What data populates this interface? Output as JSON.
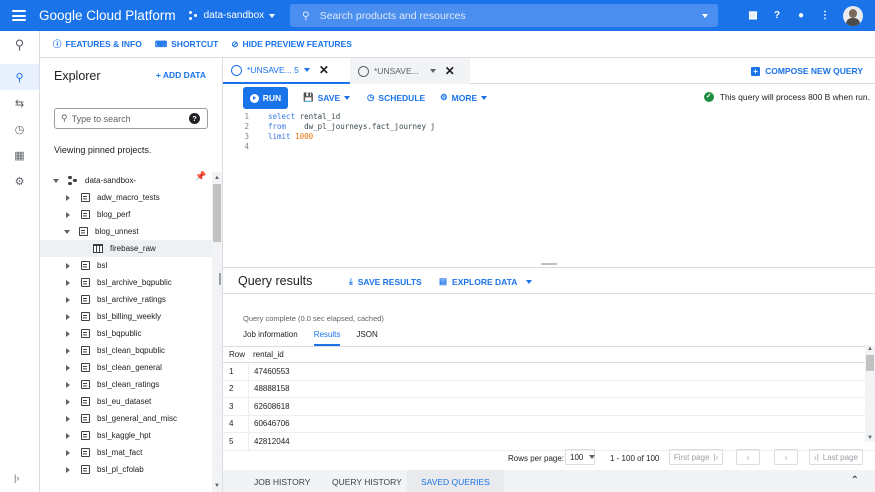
{
  "header": {
    "brand": "Google Cloud Platform",
    "project": "data-sandbox",
    "search_placeholder": "Search products and resources"
  },
  "infobar": {
    "features": "FEATURES & INFO",
    "shortcut": "SHORTCUT",
    "hide_preview": "HIDE PREVIEW FEATURES"
  },
  "explorer": {
    "title": "Explorer",
    "add_data": "+ ADD DATA",
    "search_placeholder": "Type to search",
    "pinned_text": "Viewing pinned projects.",
    "project": "data-sandbox-",
    "items": [
      {
        "label": "adw_macro_tests",
        "state": "collapsed"
      },
      {
        "label": "blog_perf",
        "state": "collapsed"
      },
      {
        "label": "blog_unnest",
        "state": "expanded"
      },
      {
        "label": "firebase_raw",
        "state": "table"
      },
      {
        "label": "bsl",
        "state": "collapsed"
      },
      {
        "label": "bsl_archive_bqpublic",
        "state": "collapsed"
      },
      {
        "label": "bsl_archive_ratings",
        "state": "collapsed"
      },
      {
        "label": "bsl_billing_weekly",
        "state": "collapsed"
      },
      {
        "label": "bsl_bqpublic",
        "state": "collapsed"
      },
      {
        "label": "bsl_clean_bqpublic",
        "state": "collapsed"
      },
      {
        "label": "bsl_clean_general",
        "state": "collapsed"
      },
      {
        "label": "bsl_clean_ratings",
        "state": "collapsed"
      },
      {
        "label": "bsl_eu_dataset",
        "state": "collapsed"
      },
      {
        "label": "bsl_general_and_misc",
        "state": "collapsed"
      },
      {
        "label": "bsl_kaggle_hpt",
        "state": "collapsed"
      },
      {
        "label": "bsl_mat_fact",
        "state": "collapsed"
      },
      {
        "label": "bsl_pl_cfolab",
        "state": "collapsed"
      }
    ]
  },
  "tabs": [
    {
      "label": "*UNSAVE... 5"
    },
    {
      "label": "*UNSAVE..."
    }
  ],
  "compose": "COMPOSE NEW QUERY",
  "toolbar": {
    "run": "RUN",
    "save": "SAVE",
    "schedule": "SCHEDULE",
    "more": "MORE",
    "process_info": "This query will process 800 B when run."
  },
  "editor": {
    "line_numbers": [
      "1",
      "2",
      "3",
      "4"
    ],
    "line1_kw": "select",
    "line1_rest": " rental_id",
    "line2_kw": "from",
    "line2_rest": "    dw_pl_journeys.fact_journey j",
    "line3_kw": "limit",
    "line3_num": "1000"
  },
  "results": {
    "title": "Query results",
    "save_results": "SAVE RESULTS",
    "explore_data": "EXPLORE DATA",
    "status": "Query complete (0.0 sec elapsed, cached)",
    "tabs": [
      "Job information",
      "Results",
      "JSON"
    ],
    "columns": [
      "Row",
      "rental_id"
    ],
    "rows": [
      {
        "row": "1",
        "value": "47460553"
      },
      {
        "row": "2",
        "value": "48888158"
      },
      {
        "row": "3",
        "value": "62608618"
      },
      {
        "row": "4",
        "value": "60646706"
      },
      {
        "row": "5",
        "value": "42812044"
      }
    ]
  },
  "pager": {
    "rows_per_page_label": "Rows per page:",
    "rows_per_page_value": "100",
    "range": "1 - 100 of 100",
    "first_page": "First page",
    "last_page": "Last page"
  },
  "bottom": {
    "job_history": "JOB HISTORY",
    "query_history": "QUERY HISTORY",
    "saved_queries": "SAVED QUERIES"
  },
  "colors": {
    "accent": "#1a73e8",
    "success": "#1e8e3e"
  }
}
